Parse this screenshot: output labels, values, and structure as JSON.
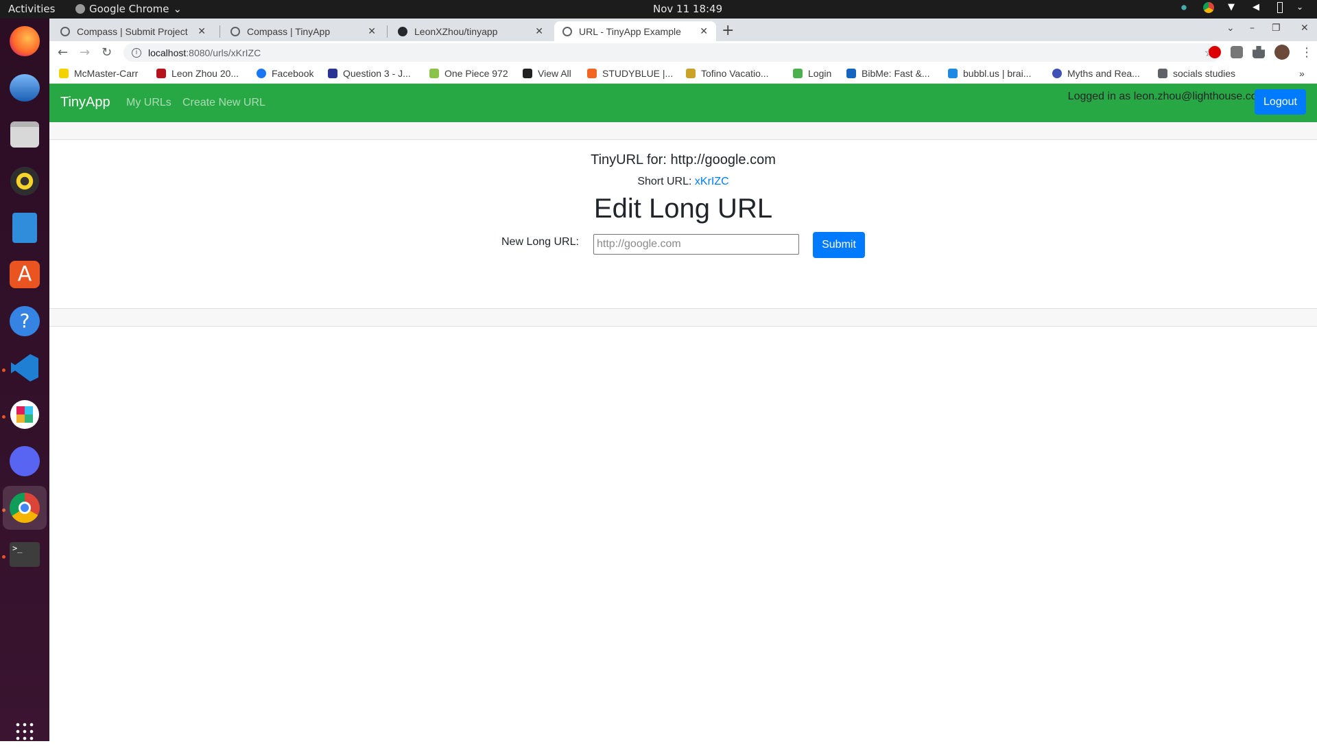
{
  "system": {
    "activities": "Activities",
    "app_menu": "Google Chrome",
    "clock": "Nov 11  18:49"
  },
  "dock": {
    "apps": [
      "firefox-icon",
      "thunderbird-icon",
      "files-icon",
      "rhythmbox-icon",
      "writer-icon",
      "software-icon",
      "help-icon",
      "vscode-icon",
      "slack-icon",
      "discord-icon",
      "chrome-icon",
      "terminal-icon",
      "show-apps-icon"
    ]
  },
  "browser": {
    "tabs": [
      {
        "title": "Compass | Submit Project"
      },
      {
        "title": "Compass | TinyApp"
      },
      {
        "title": "LeonXZhou/tinyapp"
      },
      {
        "title": "URL - TinyApp Example"
      }
    ],
    "address": {
      "host": "localhost",
      "path": ":8080/urls/xKrIZC"
    },
    "bookmarks": [
      "McMaster-Carr",
      "Leon Zhou 20...",
      "Facebook",
      "Question 3 - J...",
      "One Piece 972",
      "View All",
      "STUDYBLUE |...",
      "Tofino Vacatio...",
      "Login",
      "BibMe: Fast &...",
      "bubbl.us | brai...",
      "Myths and Rea...",
      "socials studies"
    ],
    "more_bookmarks": "»"
  },
  "app": {
    "brand": "TinyApp",
    "nav": {
      "my_urls": "My URLs",
      "create": "Create New URL"
    },
    "logged_in": "Logged in as leon.zhou@lighthouse.com",
    "logout": "Logout",
    "tiny_for_label": "TinyURL for: http://google.com",
    "short_url_label": "Short URL: ",
    "short_url_value": "xKrIZC",
    "edit_heading": "Edit Long URL",
    "form_label": "New Long URL:",
    "form_placeholder": "http://google.com",
    "submit": "Submit"
  },
  "colors": {
    "navbar": "#28a745",
    "primary": "#007bff"
  }
}
